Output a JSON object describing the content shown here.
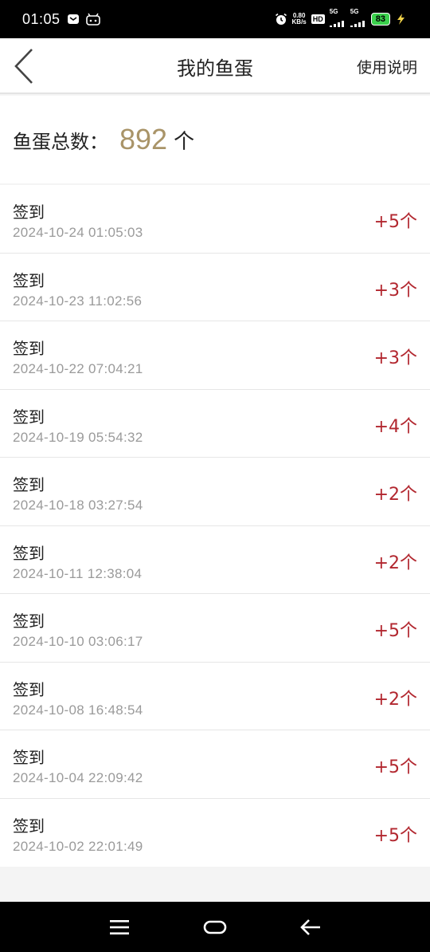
{
  "status_bar": {
    "time": "01:05",
    "net_speed_value": "0.80",
    "net_speed_unit": "KB/s",
    "hd_label": "HD",
    "sim1_label": "5G",
    "sim2_label": "5G",
    "battery": "83",
    "icons": [
      "mail-icon",
      "android-icon",
      "alarm-icon",
      "signal-icon",
      "charging-icon"
    ]
  },
  "header": {
    "title": "我的鱼蛋",
    "help_label": "使用说明"
  },
  "summary": {
    "label": "鱼蛋总数：",
    "value": "892",
    "unit": "个"
  },
  "records": [
    {
      "title": "签到",
      "time": "2024-10-24 01:05:03",
      "amount": "+5个"
    },
    {
      "title": "签到",
      "time": "2024-10-23 11:02:56",
      "amount": "+3个"
    },
    {
      "title": "签到",
      "time": "2024-10-22 07:04:21",
      "amount": "+3个"
    },
    {
      "title": "签到",
      "time": "2024-10-19 05:54:32",
      "amount": "+4个"
    },
    {
      "title": "签到",
      "time": "2024-10-18 03:27:54",
      "amount": "+2个"
    },
    {
      "title": "签到",
      "time": "2024-10-11 12:38:04",
      "amount": "+2个"
    },
    {
      "title": "签到",
      "time": "2024-10-10 03:06:17",
      "amount": "+5个"
    },
    {
      "title": "签到",
      "time": "2024-10-08 16:48:54",
      "amount": "+2个"
    },
    {
      "title": "签到",
      "time": "2024-10-04 22:09:42",
      "amount": "+5个"
    },
    {
      "title": "签到",
      "time": "2024-10-02 22:01:49",
      "amount": "+5个"
    }
  ],
  "colors": {
    "accent_gold": "#a99468",
    "amount_red": "#b2272f",
    "battery_green": "#3bd14d"
  }
}
